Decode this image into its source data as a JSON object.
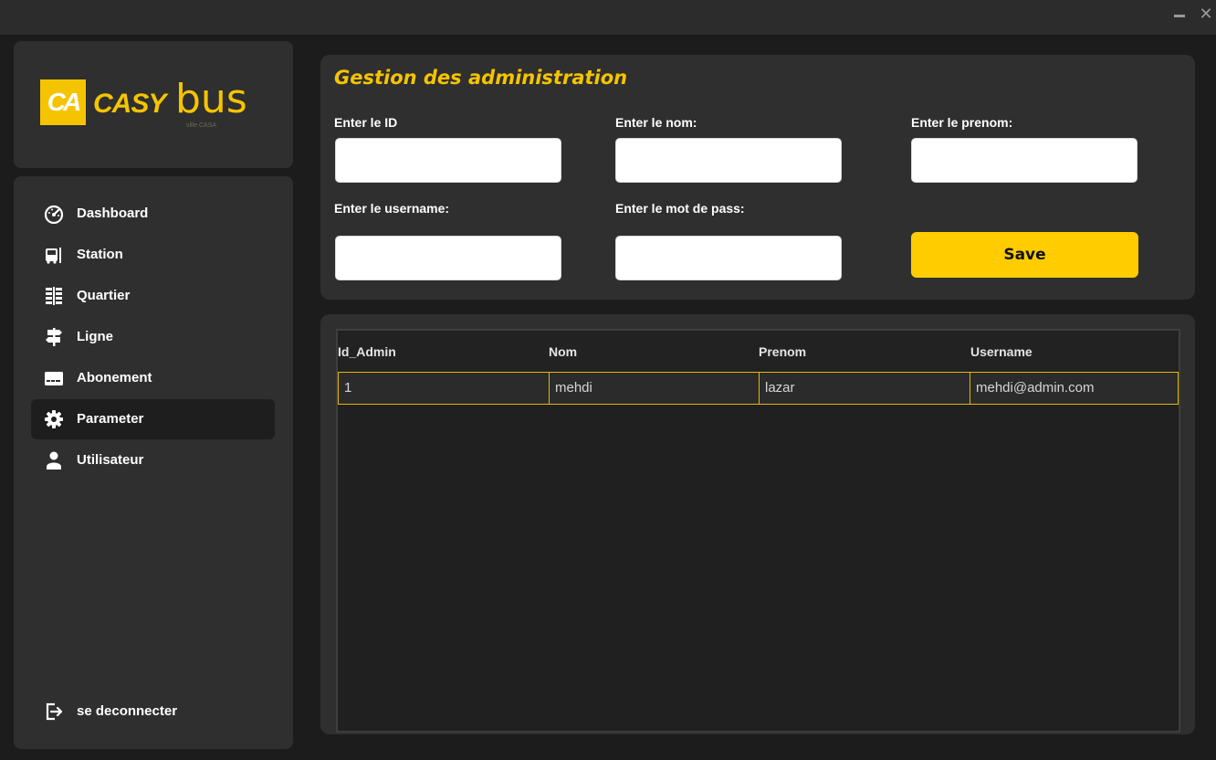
{
  "window": {
    "minimize_label": "",
    "close_label": "✕"
  },
  "logo": {
    "mark": "CA",
    "brand_a": "CASY",
    "brand_b": "bus",
    "tagline": "ville CASA"
  },
  "sidebar": {
    "items": [
      {
        "label": "Dashboard",
        "icon": "dashboard-gauge-icon"
      },
      {
        "label": "Station",
        "icon": "bus-station-icon"
      },
      {
        "label": "Quartier",
        "icon": "district-icon"
      },
      {
        "label": "Ligne",
        "icon": "signpost-icon"
      },
      {
        "label": "Abonement",
        "icon": "card-icon"
      },
      {
        "label": "Parameter",
        "icon": "gear-icon",
        "active": true
      },
      {
        "label": "Utilisateur",
        "icon": "user-icon"
      }
    ],
    "logout_label": "se deconnecter"
  },
  "form": {
    "title": "Gestion des administration",
    "labels": {
      "id": "Enter le ID",
      "nom": "Enter le nom:",
      "prenom": "Enter le prenom:",
      "username": "Enter le username:",
      "password": "Enter le mot de pass:"
    },
    "values": {
      "id": "",
      "nom": "",
      "prenom": "",
      "username": "",
      "password": ""
    },
    "save_label": "Save"
  },
  "table": {
    "columns": [
      "Id_Admin",
      "Nom",
      "Prenom",
      "Username"
    ],
    "rows": [
      [
        "1",
        "mehdi",
        "lazar",
        "mehdi@admin.com"
      ]
    ]
  },
  "colors": {
    "accent": "#ffcc00",
    "panel": "#2f2f2f",
    "background": "#1c1c1c"
  }
}
